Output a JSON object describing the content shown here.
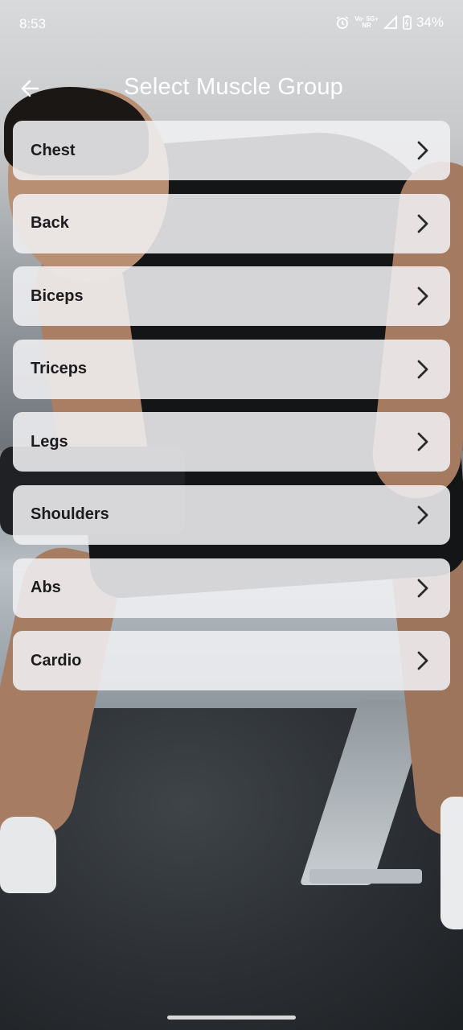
{
  "status_bar": {
    "time": "8:53",
    "network": {
      "top": "Vo· 5G+",
      "bottom": "NR"
    },
    "battery": "34%"
  },
  "header": {
    "title": "Select Muscle Group",
    "back_icon": "arrow-left-icon"
  },
  "muscle_groups": [
    {
      "label": "Chest"
    },
    {
      "label": "Back"
    },
    {
      "label": "Biceps"
    },
    {
      "label": "Triceps"
    },
    {
      "label": "Legs"
    },
    {
      "label": "Shoulders"
    },
    {
      "label": "Abs"
    },
    {
      "label": "Cardio"
    }
  ],
  "colors": {
    "card_background": "#F0F0F2",
    "text_dark": "#1C1C1E",
    "header_text": "#FFFFFF"
  },
  "icons": {
    "row_chevron": "chevron-right-icon"
  }
}
